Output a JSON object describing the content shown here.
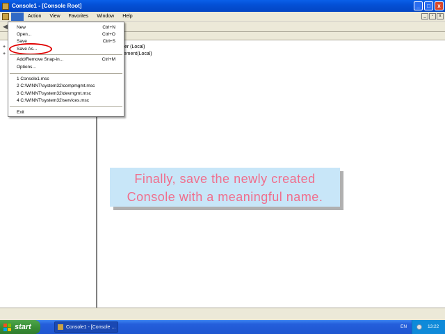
{
  "window": {
    "title": "Console1 - [Console Root]",
    "controls": {
      "minimize": "_",
      "maximize": "□",
      "close": "x"
    }
  },
  "menubar": {
    "items": [
      "Action",
      "View",
      "Favorites",
      "Window",
      "Help"
    ],
    "child_controls": {
      "minimize": "_",
      "restore": "▫",
      "close": "x"
    }
  },
  "file_menu": {
    "items": [
      {
        "label": "New",
        "shortcut": "Ctrl+N"
      },
      {
        "label": "Open...",
        "shortcut": "Ctrl+O"
      },
      {
        "label": "Save",
        "shortcut": "Ctrl+S"
      },
      {
        "label": "Save As...",
        "shortcut": ""
      },
      {
        "label": "Add/Remove Snap-in...",
        "shortcut": "Ctrl+M"
      },
      {
        "label": "Options...",
        "shortcut": ""
      },
      {
        "label": "1 Console1.msc",
        "shortcut": ""
      },
      {
        "label": "2 C:\\WINNT\\system32\\compmgmt.msc",
        "shortcut": ""
      },
      {
        "label": "3 C:\\WINNT\\system32\\devmgmt.msc",
        "shortcut": ""
      },
      {
        "label": "4 C:\\WINNT\\system32\\services.msc",
        "shortcut": ""
      },
      {
        "label": "Exit",
        "shortcut": ""
      }
    ],
    "highlighted_item": "Save As..."
  },
  "right_pane": {
    "items": [
      "ewer (Local)",
      "agement(Local)"
    ]
  },
  "tree": {
    "expanders": [
      "+",
      "+"
    ]
  },
  "caption": {
    "line1": "Finally, save the newly created",
    "line2": "Console with a meaningful name."
  },
  "taskbar": {
    "start_label": "start",
    "task_label": "Console1 - [Console ...",
    "language": "EN",
    "clock": "13:22"
  },
  "colors": {
    "titlebar": "#0450d6",
    "caption_text": "#f06e8c",
    "caption_bg": "#c8e6f8",
    "annotation": "#e00000",
    "start_button": "#3a8f37"
  }
}
